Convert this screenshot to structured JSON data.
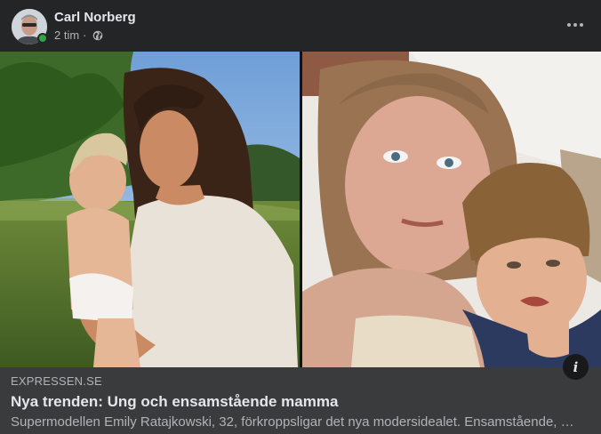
{
  "post": {
    "author": "Carl Norberg",
    "time": "2 tim",
    "separator": "·",
    "audience_icon": "globe-icon",
    "more_icon": "ellipsis-icon",
    "online": true
  },
  "link_preview": {
    "domain": "EXPRESSEN.SE",
    "title": "Nya trenden: Ung och ensamstående mamma",
    "description": "Supermodellen Emily Ratajkowski, 32, förkroppsligar det nya modersidealet. Ensamstående, …",
    "info_icon": "info-icon"
  },
  "colors": {
    "background": "#242526",
    "preview_background": "#3a3b3c",
    "online": "#31a24c",
    "text_primary": "#e4e6eb",
    "text_secondary": "#b0b3b8"
  }
}
